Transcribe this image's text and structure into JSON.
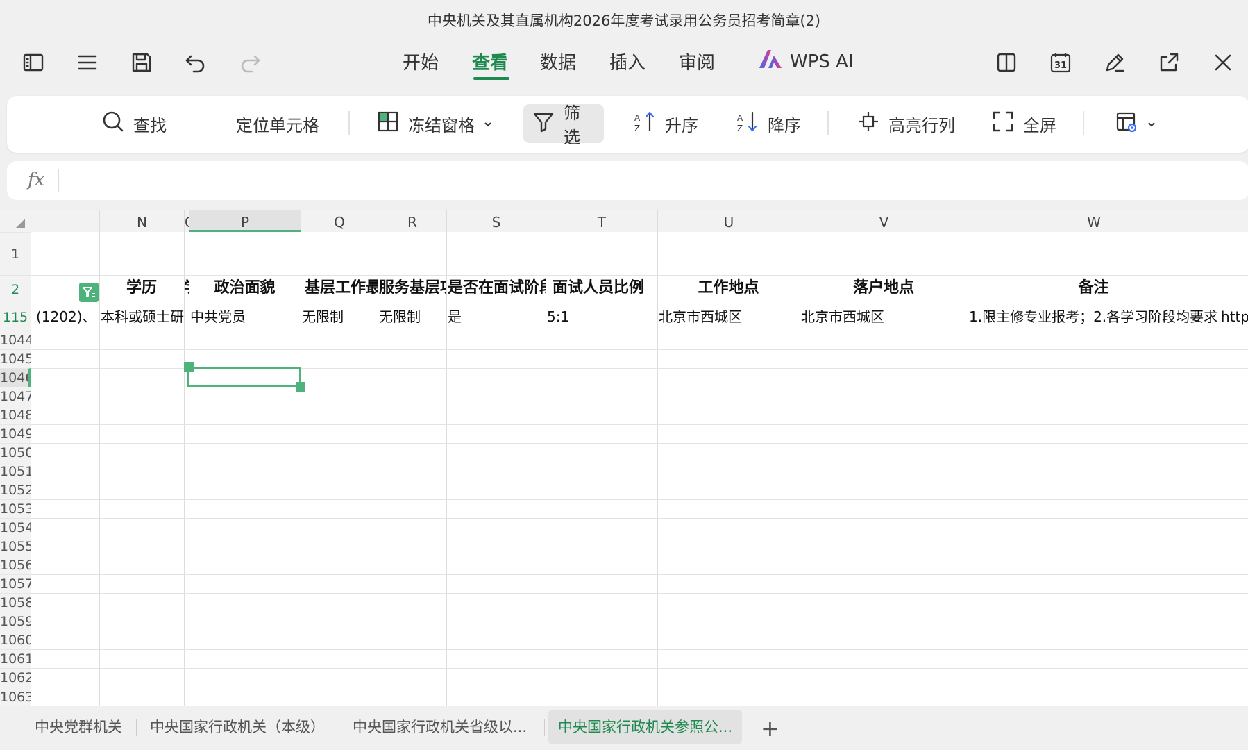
{
  "window": {
    "title": "中央机关及其直属机构2026年度考试录用公务员招考简章(2)"
  },
  "toolbar": {
    "tabs": [
      {
        "label": "开始"
      },
      {
        "label": "查看"
      },
      {
        "label": "数据"
      },
      {
        "label": "插入"
      },
      {
        "label": "审阅"
      }
    ],
    "active_tab": "查看",
    "ai_label": "WPS AI",
    "calendar_day": "31"
  },
  "ribbon": {
    "find": "查找",
    "locate": "定位单元格",
    "freeze": "冻结窗格",
    "filter": "筛选",
    "sort_asc": "升序",
    "sort_desc": "降序",
    "highlight": "高亮行列",
    "fullscreen": "全屏"
  },
  "formula_bar": {
    "fx": "fx",
    "value": ""
  },
  "grid": {
    "columns": [
      "N",
      "O",
      "P",
      "Q",
      "R",
      "S",
      "T",
      "U",
      "V",
      "W"
    ],
    "selected_column": "P",
    "rows": [
      "1",
      "2",
      "115",
      "1044",
      "1045",
      "1046",
      "1047",
      "1048",
      "1049",
      "1050",
      "1051",
      "1052",
      "1053",
      "1054",
      "1055",
      "1056",
      "1057",
      "1058",
      "1059",
      "1060",
      "1061",
      "1062",
      "1063"
    ],
    "selected_row": "1046",
    "header_row": [
      "学历",
      "学位",
      "政治面貌",
      "基层工作最低年限",
      "服务基层项目工作",
      "是否在面试阶段组织专业能",
      "面试人员比例",
      "工作地点",
      "落户地点",
      "备注"
    ],
    "data_row": {
      "m": "(1202)、",
      "n": "本科或硕士研",
      "p": "中共党员",
      "q": "无限制",
      "r": "无限制",
      "s": "是",
      "t": "5:1",
      "u": "北京市西城区",
      "v": "北京市西城区",
      "w": "1.限主修专业报考；2.各学习阶段均要求",
      "x": "http"
    }
  },
  "sheets": [
    {
      "label": "中央党群机关"
    },
    {
      "label": "中央国家行政机关（本级）"
    },
    {
      "label": "中央国家行政机关省级以..."
    },
    {
      "label": "中央国家行政机关参照公..."
    }
  ],
  "active_sheet": "中央国家行政机关参照公...",
  "colors": {
    "accent": "#1f8a50",
    "selection": "#4db37a",
    "ai_gradient": [
      "#3a6cf4",
      "#e6398a"
    ]
  }
}
